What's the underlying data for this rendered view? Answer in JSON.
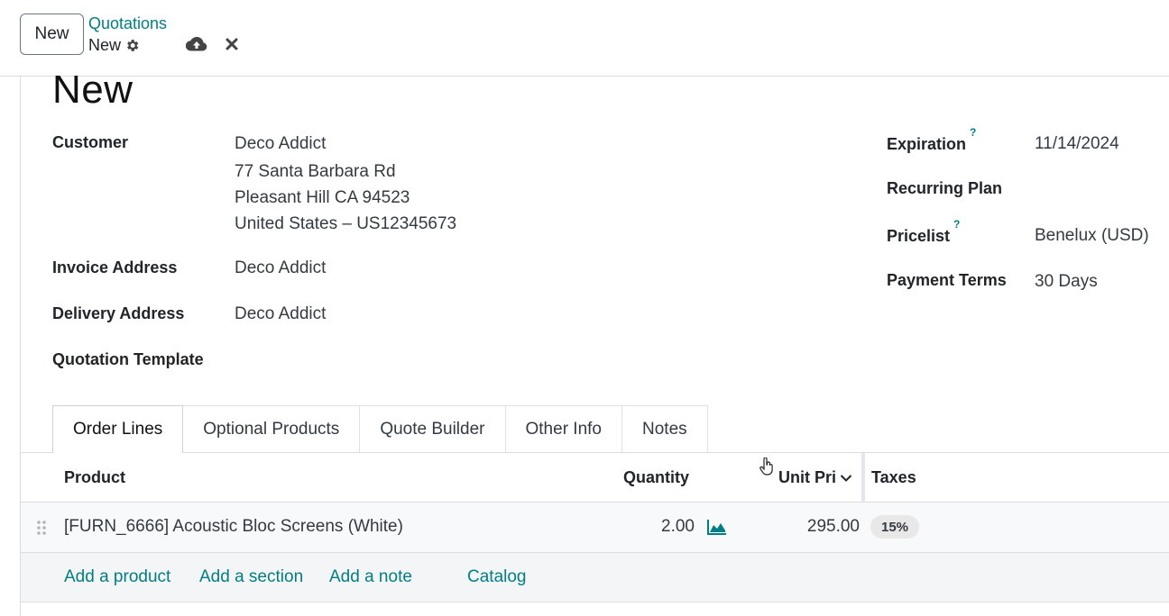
{
  "control_panel": {
    "new_button": "New",
    "breadcrumb_parent": "Quotations",
    "breadcrumb_current": "New"
  },
  "form": {
    "title": "New",
    "left_fields": {
      "customer_label": "Customer",
      "customer_name": "Deco Addict",
      "customer_address_line1": "77 Santa Barbara Rd",
      "customer_address_line2": "Pleasant Hill CA 94523",
      "customer_address_line3": "United States – US12345673",
      "invoice_label": "Invoice Address",
      "invoice_value": "Deco Addict",
      "delivery_label": "Delivery Address",
      "delivery_value": "Deco Addict",
      "template_label": "Quotation Template"
    },
    "right_fields": {
      "expiration_label": "Expiration",
      "expiration_value": "11/14/2024",
      "recurring_label": "Recurring Plan",
      "pricelist_label": "Pricelist",
      "pricelist_value": "Benelux (USD)",
      "payment_label": "Payment Terms",
      "payment_value": "30 Days",
      "help_mark": "?"
    }
  },
  "tabs": [
    {
      "label": "Order Lines"
    },
    {
      "label": "Optional Products"
    },
    {
      "label": "Quote Builder"
    },
    {
      "label": "Other Info"
    },
    {
      "label": "Notes"
    }
  ],
  "order_lines": {
    "columns": {
      "product": "Product",
      "quantity": "Quantity",
      "unit_price": "Unit Pri",
      "taxes": "Taxes"
    },
    "rows": [
      {
        "product": "[FURN_6666] Acoustic Bloc Screens (White)",
        "quantity": "2.00",
        "unit_price": "295.00",
        "tax": "15%"
      }
    ],
    "actions": {
      "add_product": "Add a product",
      "add_section": "Add a section",
      "add_note": "Add a note",
      "catalog": "Catalog"
    }
  },
  "colors": {
    "accent": "#017e84",
    "text": "#212529"
  },
  "icons": {
    "gear": "gear-icon",
    "save": "cloud-upload-icon",
    "discard": "close-icon",
    "forecast": "area-chart-icon",
    "drag": "drag-handle-icon",
    "sort": "chevron-down-icon"
  }
}
